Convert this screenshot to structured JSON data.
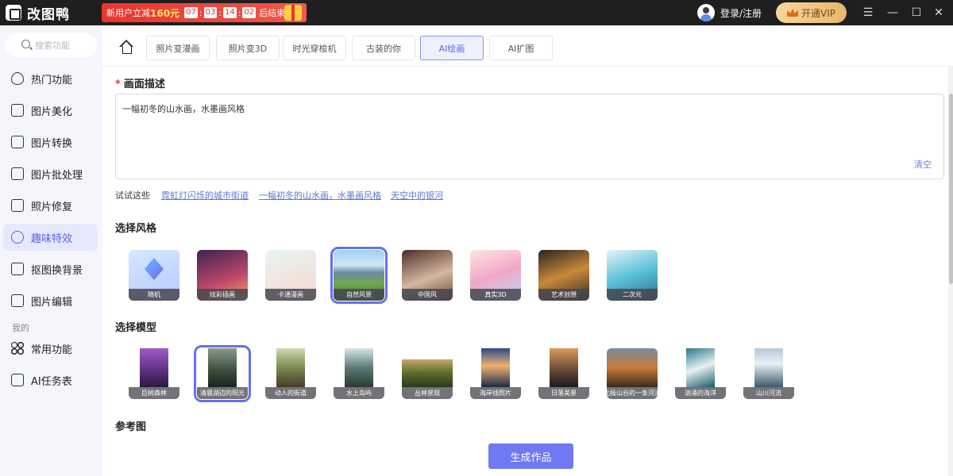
{
  "titlebar": {
    "app_name": "改图鸭",
    "promo": {
      "text_prefix": "新用户立减",
      "amount": "160元",
      "cd1": "07",
      "cd2": "03",
      "cd3": "14",
      "cd4": "02",
      "suffix": "后结束"
    },
    "login_label": "登录/注册",
    "vip_label": "开通VIP",
    "controls": {
      "menu": "☰",
      "minimize": "—",
      "maximize": "☐",
      "close": "✕"
    }
  },
  "sidebar": {
    "search_placeholder": "搜索功能",
    "items": [
      {
        "label": "热门功能",
        "icon": "flame-icon"
      },
      {
        "label": "图片美化",
        "icon": "image-beautify-icon"
      },
      {
        "label": "图片转换",
        "icon": "convert-icon"
      },
      {
        "label": "图片批处理",
        "icon": "batch-icon"
      },
      {
        "label": "照片修复",
        "icon": "repair-icon"
      },
      {
        "label": "趣味特效",
        "icon": "sparkle-icon",
        "active": true
      },
      {
        "label": "抠图换背景",
        "icon": "cutout-icon"
      },
      {
        "label": "图片编辑",
        "icon": "edit-icon"
      }
    ],
    "mine_label": "我的",
    "mine_items": [
      {
        "label": "常用功能",
        "icon": "grid-icon"
      },
      {
        "label": "AI任务表",
        "icon": "task-list-icon"
      }
    ]
  },
  "tabs": [
    "照片变漫画",
    "照片变3D",
    "时光穿梭机",
    "古装的你",
    "AI绘画",
    "AI扩图"
  ],
  "active_tab": "AI绘画",
  "form": {
    "description_label": "画面描述",
    "description_value": "一幅初冬的山水画，水墨画风格",
    "clear_label": "清空",
    "try_label": "试试这些",
    "suggestions": [
      "霓虹灯闪烁的城市街道",
      "一幅初冬的山水画，水墨画风格",
      "天空中的银河"
    ],
    "style_label": "选择风格",
    "styles": [
      "随机",
      "炫彩插画",
      "卡通漫画",
      "自然风景",
      "中国风",
      "真实3D",
      "艺术创想",
      "二次元"
    ],
    "selected_style": "自然风景",
    "model_label": "选择模型",
    "models": [
      "巨树森林",
      "清晨湖边的阳光",
      "动人的街道",
      "水上岛屿",
      "丛林景观",
      "海岸线照片",
      "日落美景",
      "北极山谷的一条河流",
      "汹涌的海洋",
      "山川河流"
    ],
    "selected_model": "清晨湖边的阳光",
    "reference_label": "参考图",
    "generate_label": "生成作品"
  },
  "colors": {
    "accent": "#6e79f3",
    "titlebar": "#1f1f1f",
    "promo": "#e8352f",
    "vip": "#e7b76b"
  }
}
